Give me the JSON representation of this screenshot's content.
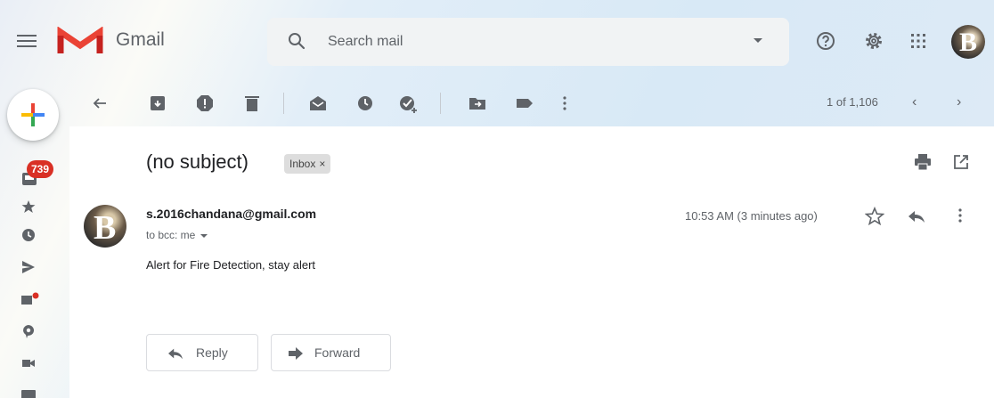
{
  "app": {
    "name": "Gmail"
  },
  "search": {
    "placeholder": "Search mail"
  },
  "rail": {
    "inbox_count": "739"
  },
  "toolbar": {
    "pager": "1 of 1,106"
  },
  "message": {
    "subject": "(no subject)",
    "label": "Inbox",
    "label_remove": "×",
    "sender_email": "s.2016chandana@gmail.com",
    "recipients": "to bcc: me",
    "time": "10:53 AM (3 minutes ago)",
    "body": "Alert for Fire Detection, stay alert",
    "reply_label": "Reply",
    "forward_label": "Forward"
  },
  "avatar_letter": "B",
  "colors": {
    "gmail_red": "#ea4335",
    "badge_red": "#d93025",
    "icon_gray": "#5f6368"
  },
  "icons": [
    "menu-icon",
    "gmail-logo-icon",
    "search-icon",
    "help-icon",
    "settings-icon",
    "apps-icon",
    "back-icon",
    "archive-icon",
    "report-spam-icon",
    "delete-icon",
    "mark-unread-icon",
    "snooze-icon",
    "add-task-icon",
    "move-to-icon",
    "label-icon",
    "more-icon",
    "print-icon",
    "open-new-window-icon",
    "star-icon",
    "reply-icon",
    "forward-icon"
  ]
}
